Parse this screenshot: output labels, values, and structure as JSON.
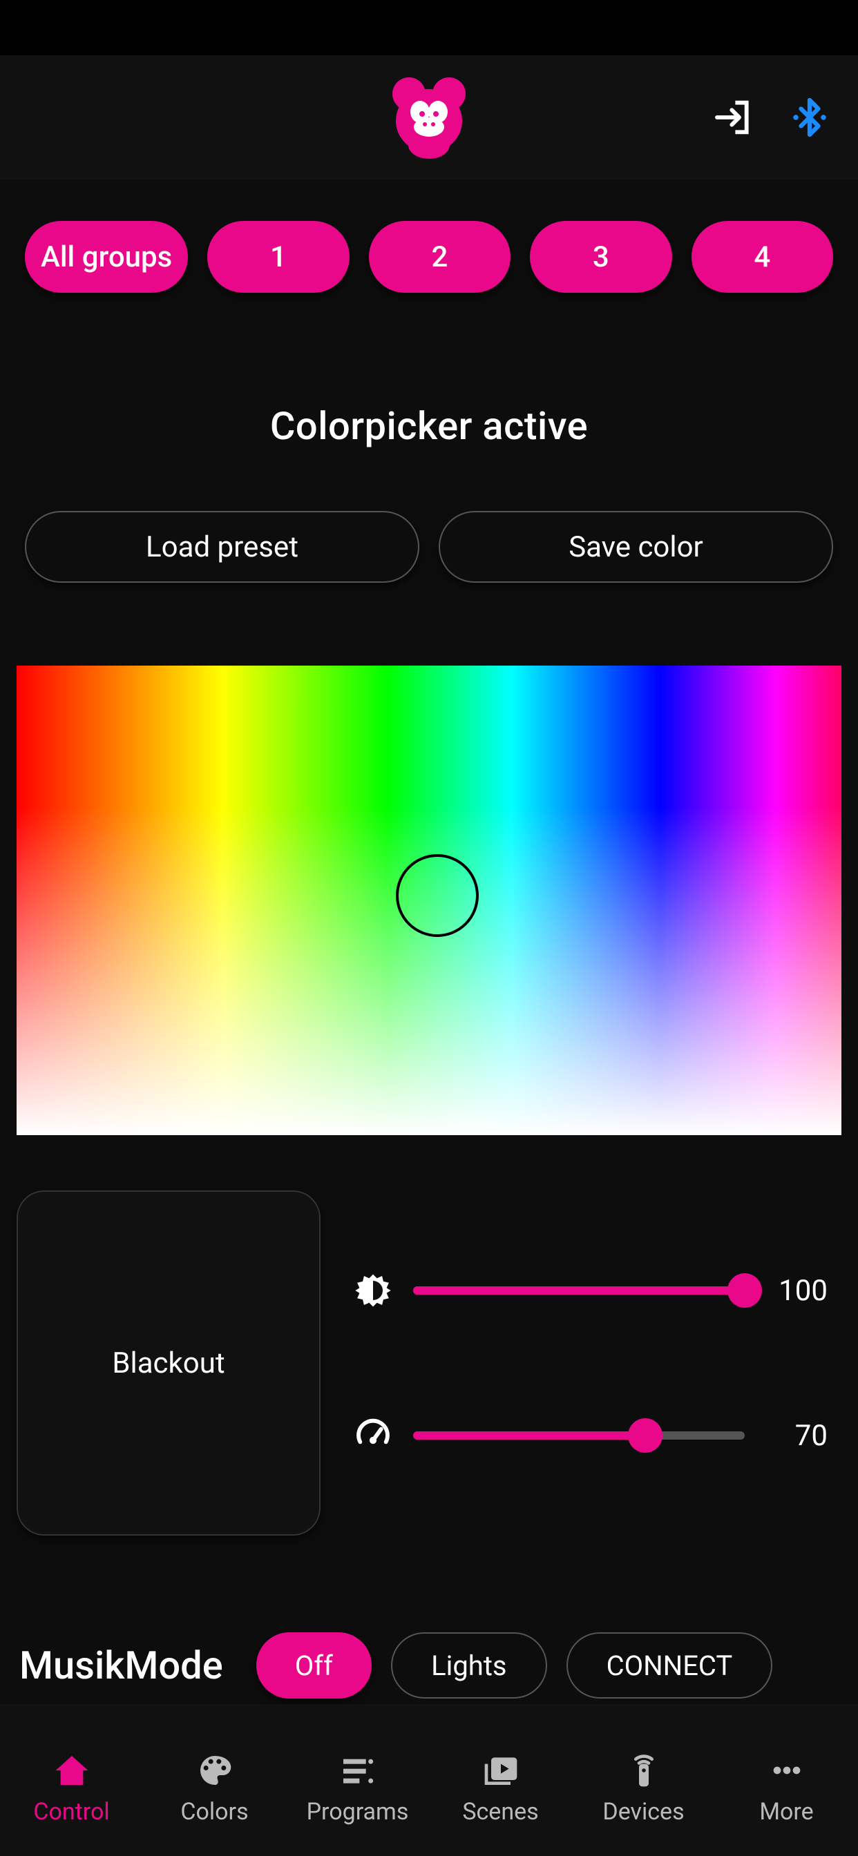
{
  "colors": {
    "accent": "#ea088a",
    "bluetooth": "#1a8cff"
  },
  "header": {
    "logo": "monkey-logo",
    "login_icon": "login-icon",
    "bluetooth_icon": "bluetooth-icon"
  },
  "groups": {
    "items": [
      "All groups",
      "1",
      "2",
      "3",
      "4"
    ]
  },
  "section_title": "Colorpicker active",
  "preset": {
    "load_label": "Load preset",
    "save_label": "Save color"
  },
  "blackout_label": "Blackout",
  "sliders": {
    "brightness": {
      "icon": "brightness-icon",
      "value": 100,
      "display": "100"
    },
    "speed": {
      "icon": "speed-icon",
      "value": 70,
      "display": "70"
    }
  },
  "musik": {
    "label": "MusikMode",
    "off_label": "Off",
    "lights_label": "Lights",
    "connect_label": "CONNECT"
  },
  "nav": {
    "items": [
      {
        "label": "Control",
        "icon": "home-icon",
        "active": true
      },
      {
        "label": "Colors",
        "icon": "palette-icon",
        "active": false
      },
      {
        "label": "Programs",
        "icon": "list-icon",
        "active": false
      },
      {
        "label": "Scenes",
        "icon": "video-library-icon",
        "active": false
      },
      {
        "label": "Devices",
        "icon": "remote-icon",
        "active": false
      },
      {
        "label": "More",
        "icon": "more-icon",
        "active": false
      }
    ]
  }
}
